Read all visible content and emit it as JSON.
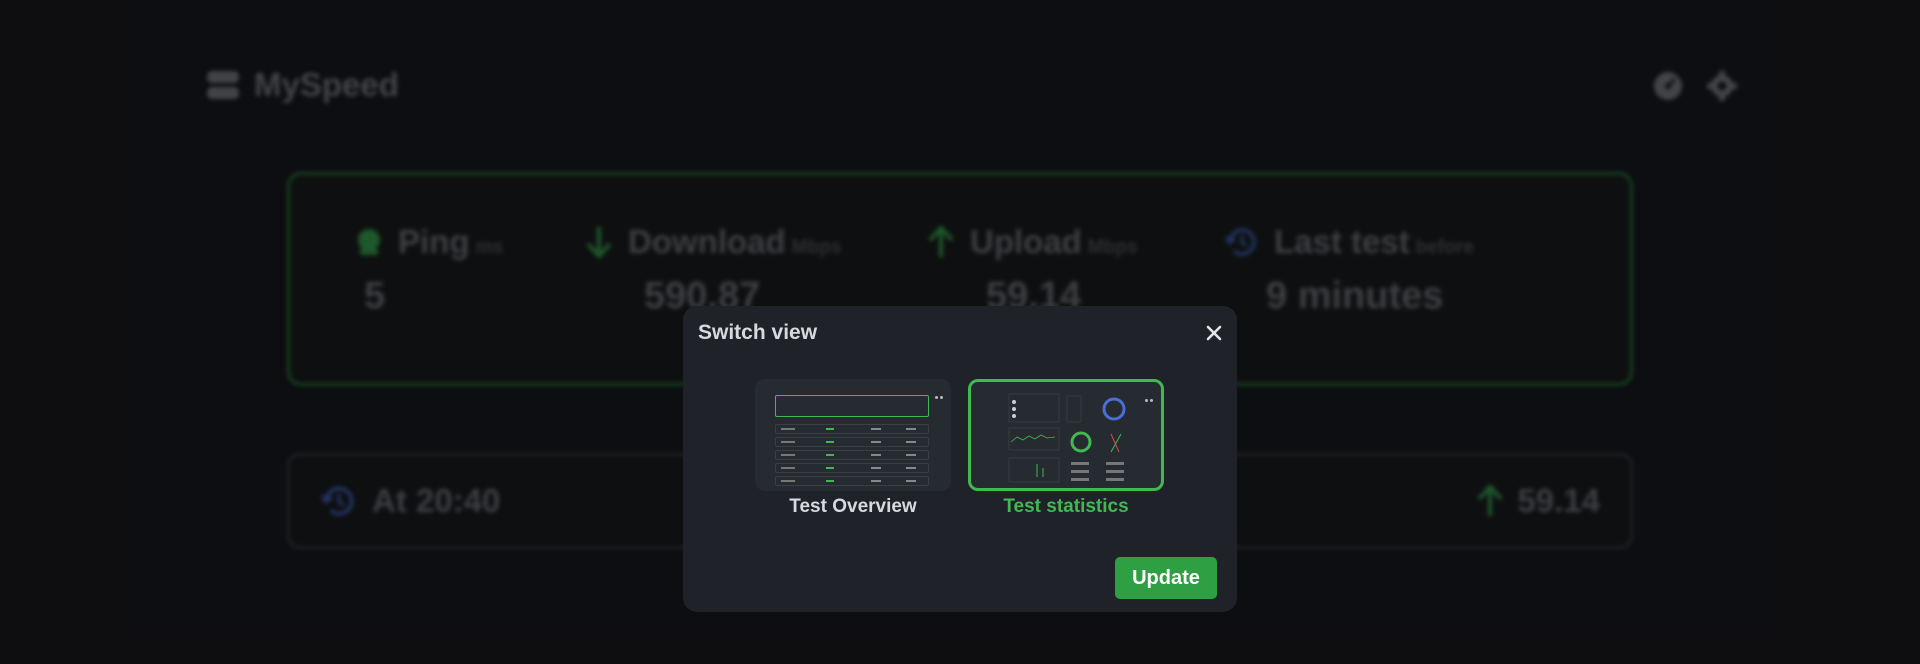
{
  "app": {
    "title": "MySpeed",
    "header_icons": [
      "speedometer-icon",
      "gear-icon"
    ]
  },
  "stats": {
    "ping": {
      "label": "Ping",
      "unit": "ms",
      "value": "5"
    },
    "download": {
      "label": "Download",
      "unit": "Mbps",
      "value": "590.87"
    },
    "upload": {
      "label": "Upload",
      "unit": "Mbps",
      "value": "59.14"
    },
    "last_test": {
      "label": "Last test",
      "unit": "before",
      "value": "9 minutes"
    }
  },
  "recent_test": {
    "time": "At 20:40",
    "upload": "59.14"
  },
  "modal": {
    "title": "Switch view",
    "options": [
      {
        "label": "Test Overview",
        "selected": false
      },
      {
        "label": "Test statistics",
        "selected": true
      }
    ],
    "update_label": "Update"
  },
  "colors": {
    "accent": "#3fb950",
    "background": "#131418",
    "modal_bg": "#1f2228",
    "history_icon": "#2f4a8a"
  }
}
